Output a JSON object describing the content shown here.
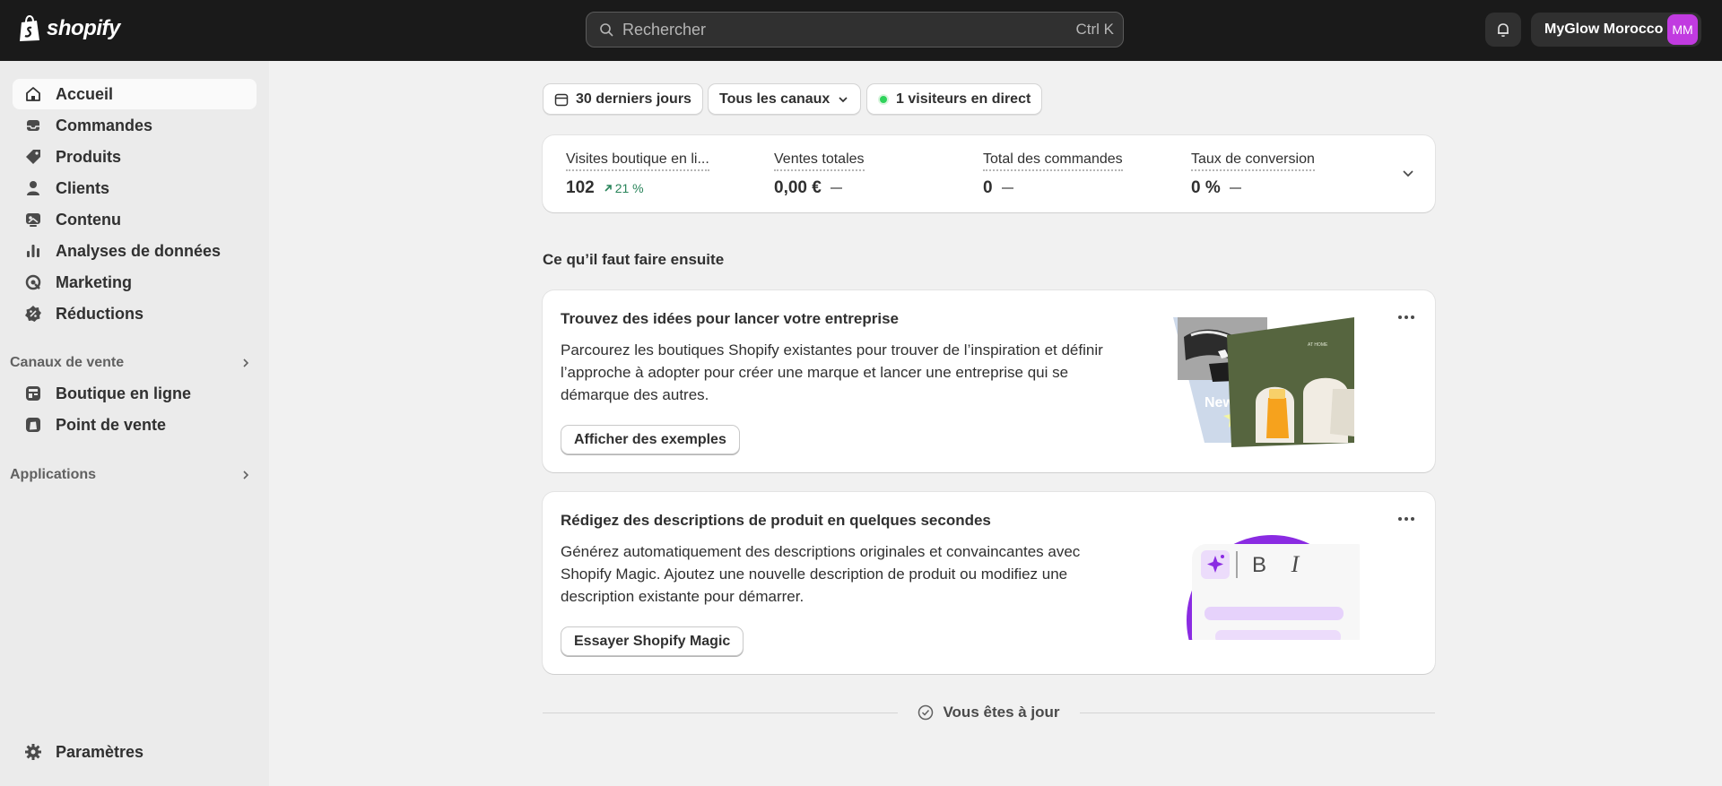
{
  "topbar": {
    "brand": "shopify",
    "search_placeholder": "Rechercher",
    "search_shortcut": "Ctrl K",
    "account_name": "MyGlow Morocco",
    "account_initials": "MM"
  },
  "sidebar": {
    "items": [
      {
        "label": "Accueil",
        "icon": "home-icon",
        "active": true
      },
      {
        "label": "Commandes",
        "icon": "inbox-icon"
      },
      {
        "label": "Produits",
        "icon": "tag-icon"
      },
      {
        "label": "Clients",
        "icon": "person-icon"
      },
      {
        "label": "Contenu",
        "icon": "image-icon"
      },
      {
        "label": "Analyses de données",
        "icon": "bar-chart-icon"
      },
      {
        "label": "Marketing",
        "icon": "target-icon"
      },
      {
        "label": "Réductions",
        "icon": "discount-icon"
      }
    ],
    "sales_channels_label": "Canaux de vente",
    "sales_channels": [
      {
        "label": "Boutique en ligne",
        "icon": "store-icon"
      },
      {
        "label": "Point de vente",
        "icon": "pos-icon"
      }
    ],
    "apps_label": "Applications",
    "settings_label": "Paramètres"
  },
  "filters": {
    "date_range": "30 derniers jours",
    "channels": "Tous les canaux",
    "live_visitors": "1 visiteurs en direct"
  },
  "metrics": [
    {
      "label": "Visites boutique en li...",
      "value": "102",
      "trend": "21 %"
    },
    {
      "label": "Ventes totales",
      "value": "0,00 €"
    },
    {
      "label": "Total des commandes",
      "value": "0"
    },
    {
      "label": "Taux de conversion",
      "value": "0 %"
    }
  ],
  "next_steps": {
    "title": "Ce qu’il faut faire ensuite",
    "cards": [
      {
        "title": "Trouvez des idées pour lancer votre entreprise",
        "body": "Parcourez les boutiques Shopify existantes pour trouver de l’inspiration et définir l’approche à adopter pour créer une marque et lancer une entreprise qui se démarque des autres.",
        "button": "Afficher des exemples",
        "illustration_text_1": "New",
        "illustration_text_2": "AT HOME"
      },
      {
        "title": "Rédigez des descriptions de produit en quelques secondes",
        "body": "Générez automatiquement des descriptions originales et convaincantes avec Shopify Magic. Ajoutez une nouvelle description de produit ou modifiez une description existante pour démarrer.",
        "button": "Essayer Shopify Magic",
        "illustration_bold": "B",
        "illustration_italic": "I"
      }
    ]
  },
  "footer_status": "Vous êtes à jour",
  "colors": {
    "topbar": "#1a1a1a",
    "avatar": "#c13be0",
    "live_dot": "#2fd35b",
    "trend_green": "#29845a",
    "magic_purple": "#8a2be2"
  }
}
